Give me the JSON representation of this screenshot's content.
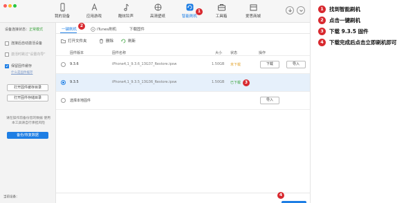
{
  "nav": {
    "items": [
      {
        "label": "我的设备",
        "icon": "phone-icon"
      },
      {
        "label": "应用游戏",
        "icon": "app-store-icon"
      },
      {
        "label": "酷炫铃声",
        "icon": "music-note-icon"
      },
      {
        "label": "高清壁纸",
        "icon": "flower-icon"
      },
      {
        "label": "智能刷机",
        "icon": "refresh-icon"
      },
      {
        "label": "工具箱",
        "icon": "toolbox-icon"
      },
      {
        "label": "爱思商城",
        "icon": "shop-icon"
      }
    ],
    "active_index": 4
  },
  "badges": [
    "1",
    "2",
    "3",
    "4"
  ],
  "sidebar": {
    "status_label": "设备连接状态：",
    "status_value": "正常模式",
    "opt1": "连接后自动激活设备",
    "opt2": "激活时跳过\"设置向导\"",
    "opt3": "保留固件缓存",
    "cache_link": "什么是固件缓存",
    "btn_firmware": "打开固件缓存目录",
    "btn_storage": "打开固件存储目录",
    "warning": "请在操作前备份您的数据 使用本工具请自行承担风险",
    "backup_btn": "备份/恢复数据",
    "device_label": "当前设备："
  },
  "tabs": [
    "一键刷机",
    "iTunes刷机",
    "下载固件"
  ],
  "toolbar": {
    "open_folder": "打开文件夹",
    "delete": "删除",
    "refresh": "刷新"
  },
  "table": {
    "headers": [
      "固件版本",
      "固件名称",
      "大小",
      "状态",
      "操作"
    ],
    "rows": [
      {
        "version": "9.3.6",
        "name": "iPhone4,1_9.3.6_13G37_Restore.ipsw",
        "size": "1.50GB",
        "status": "未下载",
        "downloaded": false,
        "selected": false,
        "btn_download": "下载",
        "btn_import": "导入"
      },
      {
        "version": "9.3.5",
        "name": "iPhone4,1_9.3.5_13G36_Restore.ipsw",
        "size": "1.50GB",
        "status": "已下载",
        "downloaded": true,
        "selected": true
      },
      {
        "version": "选择本地固件",
        "import_btn": "导入"
      }
    ]
  },
  "steps": [
    {
      "num": "1",
      "text": "找到智能刷机"
    },
    {
      "num": "2",
      "text": "点击一键刷机"
    },
    {
      "num": "3",
      "text": "下载 9.3.5 固件"
    },
    {
      "num": "4",
      "text": "下载完成后点击立即刷机即可"
    }
  ],
  "colors": {
    "accent": "#1e7ee4",
    "badge": "#d8292f",
    "ok": "#39a33b",
    "warn": "#e2a22a"
  }
}
